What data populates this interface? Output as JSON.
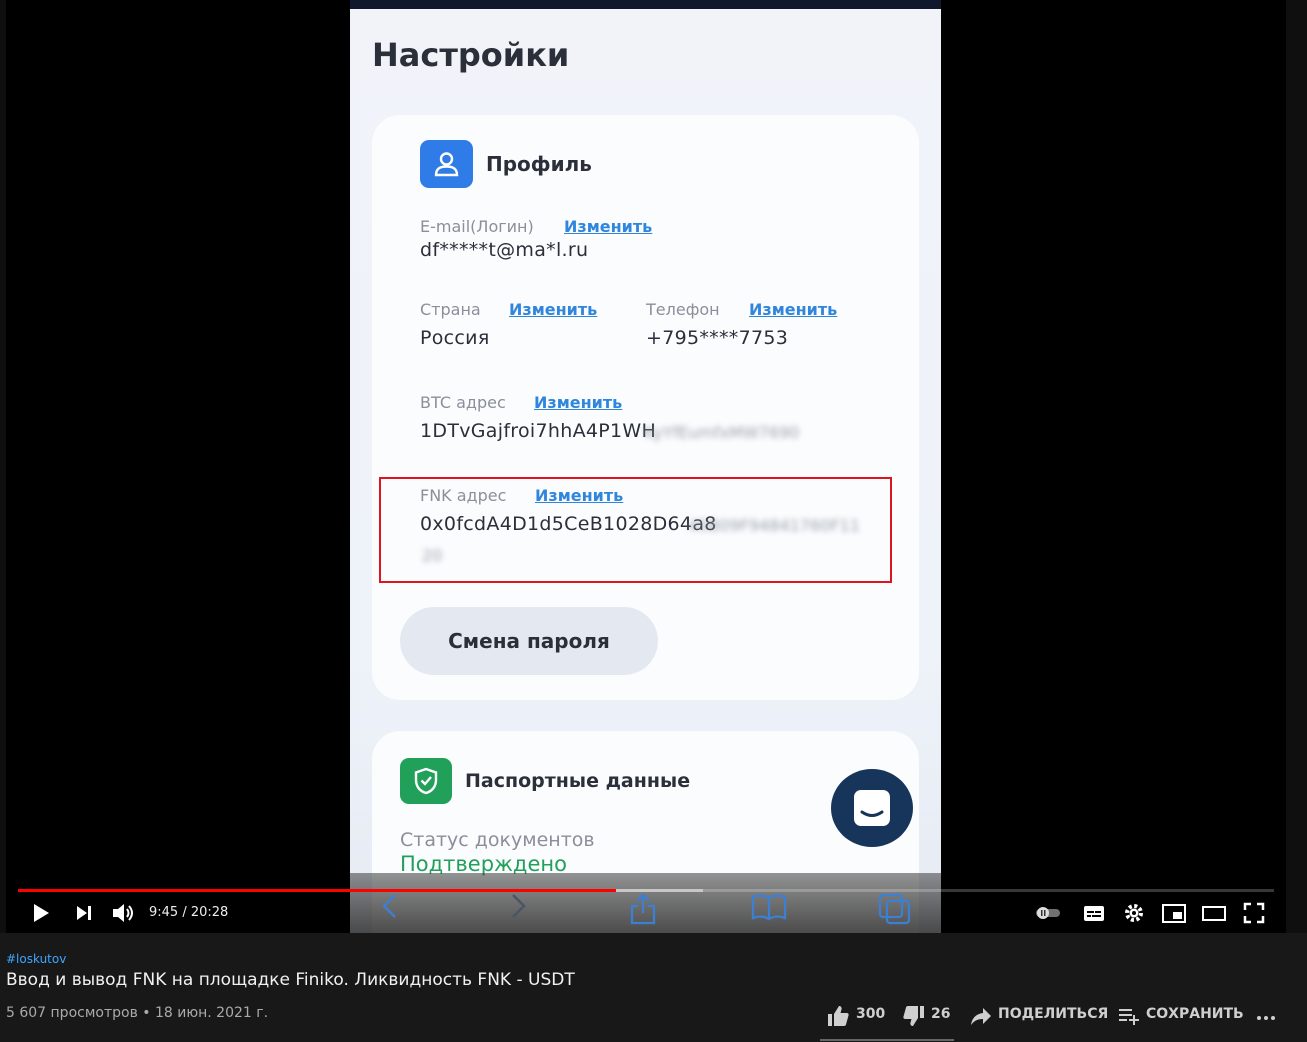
{
  "app": {
    "settings_title": "Настройки",
    "profile": {
      "title": "Профиль",
      "email_label": "E-mail(Логин)",
      "email_change": "Изменить",
      "email_value": "df*****t@ma*l.ru",
      "country_label": "Страна",
      "country_change": "Изменить",
      "country_value": "Россия",
      "phone_label": "Телефон",
      "phone_change": "Изменить",
      "phone_value": "+795****7753",
      "btc_label": "BTC адрес",
      "btc_change": "Изменить",
      "btc_value": "1DTvGajfroi7hhA4P1WH",
      "btc_blurred": "KyYfEumfxMW7690",
      "fnk_label": "FNK адрес",
      "fnk_change": "Изменить",
      "fnk_value": "0x0fcdA4D1d5CeB1028D64a8",
      "fnk_blurred": "45B09F94841760F11",
      "fnk_blurred_2": "20",
      "password_button": "Смена пароля"
    },
    "passport": {
      "title": "Паспортные данные",
      "status_label": "Статус документов",
      "status_value": "Подтверждено"
    }
  },
  "player": {
    "time": "9:45 / 20:28",
    "progress": 0.476,
    "buffered": 0.545
  },
  "video": {
    "hashtag": "#loskutov",
    "title": "Ввод и вывод FNK на площадке Finiko. Ликвидность FNK - USDT",
    "meta": "5 607 просмотров • 18 июн. 2021 г.",
    "likes": "300",
    "dislikes": "26",
    "share": "ПОДЕЛИТЬСЯ",
    "save": "СОХРАНИТЬ"
  }
}
